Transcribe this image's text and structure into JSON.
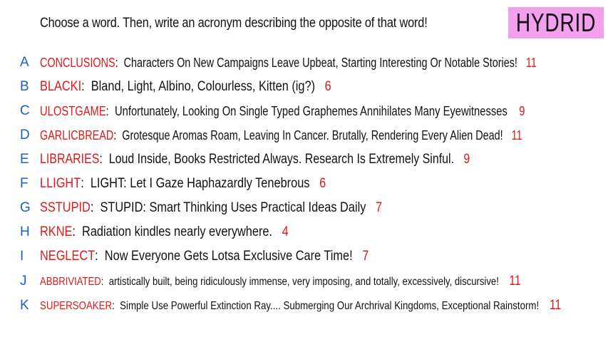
{
  "prompt": "Choose a word. Then, write an acronym describing the opposite of that word!",
  "badge": "HYDRID",
  "rows": [
    {
      "letter": "A",
      "word": "CONCLUSIONS",
      "acronym": "Characters On New Campaigns Leave Upbeat, Starting Interesting Or Notable Stories!",
      "number": "11"
    },
    {
      "letter": "B",
      "word": "BLACKI",
      "acronym": "Bland, Light, Albino, Colourless,  Kitten (ig?)",
      "number": "6"
    },
    {
      "letter": "C",
      "word": "ULOSTGAME",
      "acronym": "Unfortunately, Looking On Single Typed Graphemes Annihilates Many Eyewitnesses",
      "number": "9"
    },
    {
      "letter": "D",
      "word": "GARLICBREAD",
      "acronym": "Grotesque Aromas Roam, Leaving In Cancer. Brutally, Rendering Every Alien Dead!",
      "number": "11"
    },
    {
      "letter": "E",
      "word": "LIBRARIES",
      "acronym": "Loud Inside, Books Restricted Always. Research Is Extremely Sinful.",
      "number": "9"
    },
    {
      "letter": "F",
      "word": "LLIGHT",
      "acronym": "LIGHT: Let I Gaze Haphazardly Tenebrous",
      "number": "6"
    },
    {
      "letter": "G",
      "word": "SSTUPID",
      "acronym": "STUPID: Smart Thinking Uses Practical Ideas Daily",
      "number": "7"
    },
    {
      "letter": "H",
      "word": "RKNE",
      "acronym": "Radiation kindles nearly everywhere.",
      "number": "4"
    },
    {
      "letter": "I",
      "word": "NEGLECT",
      "acronym": "Now Everyone Gets Lotsa Exclusive Care Time!",
      "number": "7"
    },
    {
      "letter": "J",
      "word": "ABBRIVIATED",
      "acronym": "artistically built, being ridiculously immense, very imposing, and totally, excessively, discursive!",
      "number": "11"
    },
    {
      "letter": "K",
      "word": "SUPERSOAKER",
      "acronym": "Simple Use Powerful Extinction Ray.... Submerging Our Archrival Kingdoms, Exceptional Rainstorm!",
      "number": "11"
    }
  ]
}
